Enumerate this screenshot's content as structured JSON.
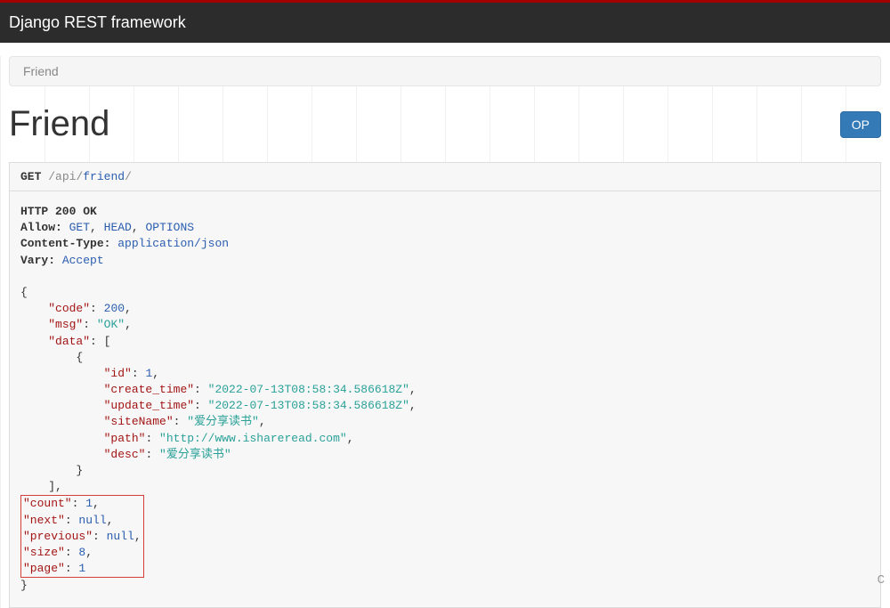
{
  "navbar": {
    "brand": "Django REST framework"
  },
  "breadcrumb": {
    "item": "Friend"
  },
  "page": {
    "title": "Friend"
  },
  "buttons": {
    "options": "OP"
  },
  "request": {
    "method": "GET",
    "path_seg1": "api",
    "path_seg2": "friend",
    "sep": "/"
  },
  "response": {
    "status_line": "HTTP 200 OK",
    "allow_label": "Allow:",
    "allow_v1": "GET",
    "allow_v2": "HEAD",
    "allow_v3": "OPTIONS",
    "ctype_label": "Content-Type:",
    "ctype_value": "application/json",
    "vary_label": "Vary:",
    "vary_value": "Accept"
  },
  "json_body": {
    "k_code": "\"code\"",
    "v_code": "200",
    "k_msg": "\"msg\"",
    "v_msg": "\"OK\"",
    "k_data": "\"data\"",
    "k_id": "\"id\"",
    "v_id": "1",
    "k_create_time": "\"create_time\"",
    "v_create_time": "\"2022-07-13T08:58:34.586618Z\"",
    "k_update_time": "\"update_time\"",
    "v_update_time": "\"2022-07-13T08:58:34.586618Z\"",
    "k_siteName": "\"siteName\"",
    "v_siteName": "\"爱分享读书\"",
    "k_path": "\"path\"",
    "v_path": "\"http://www.ishareread.com\"",
    "k_desc": "\"desc\"",
    "v_desc": "\"爱分享读书\"",
    "k_count": "\"count\"",
    "v_count": "1",
    "k_next": "\"next\"",
    "v_next": "null",
    "k_previous": "\"previous\"",
    "v_previous": "null",
    "k_size": "\"size\"",
    "v_size": "8",
    "k_page": "\"page\"",
    "v_page": "1"
  },
  "bottom_letter": "C"
}
